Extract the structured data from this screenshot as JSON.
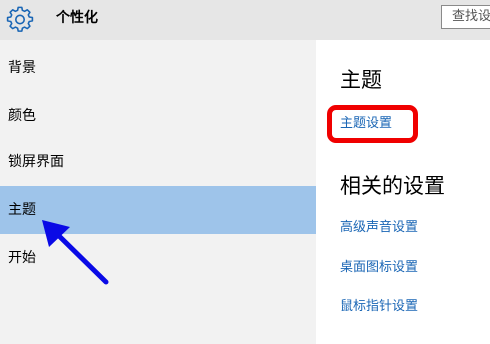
{
  "window": {
    "title": "个性化",
    "gear_icon": "gear-icon",
    "search_text": "查找设置"
  },
  "sidebar": {
    "items": [
      {
        "label": "背景"
      },
      {
        "label": "颜色"
      },
      {
        "label": "锁屏界面"
      },
      {
        "label": "主题"
      },
      {
        "label": "开始"
      }
    ],
    "selected_index": 3,
    "selected_color": "#9ec4ea"
  },
  "main": {
    "section_title": "主题",
    "theme_settings_link": "主题设置",
    "related_title": "相关的设置",
    "related_links": [
      {
        "label": "高级声音设置"
      },
      {
        "label": "桌面图标设置"
      },
      {
        "label": "鼠标指针设置"
      }
    ],
    "link_color": "#1a66b5"
  },
  "annotations": {
    "highlight_color": "#f00000",
    "arrow_color": "#0a0ae6",
    "arrow_icon": "arrow-icon"
  }
}
